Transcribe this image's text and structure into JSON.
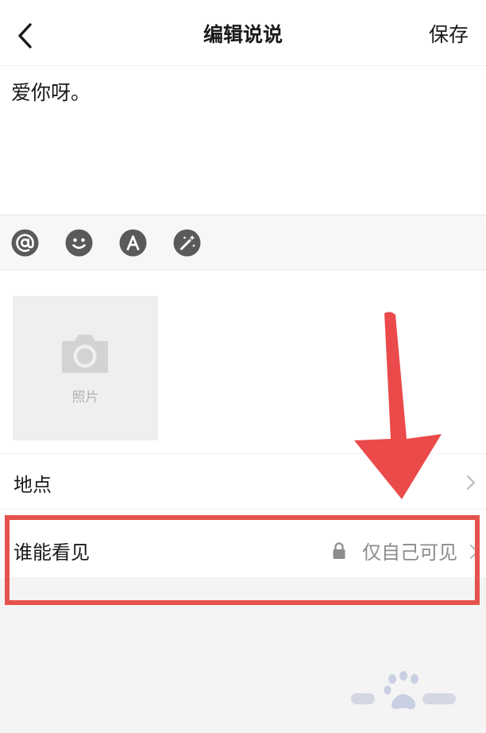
{
  "header": {
    "title": "编辑说说",
    "save_label": "保存"
  },
  "editor": {
    "text": "爱你呀。"
  },
  "toolbar": {
    "icons": [
      "at-icon",
      "emoji-icon",
      "font-icon",
      "magic-wand-icon"
    ]
  },
  "media": {
    "photo_label": "照片"
  },
  "location": {
    "label": "地点"
  },
  "visibility": {
    "label": "谁能看见",
    "value": "仅自己可见"
  },
  "colors": {
    "accent_red": "#e4534c",
    "icon_gray": "#5a5a5a",
    "muted_text": "#8c8c8c"
  }
}
